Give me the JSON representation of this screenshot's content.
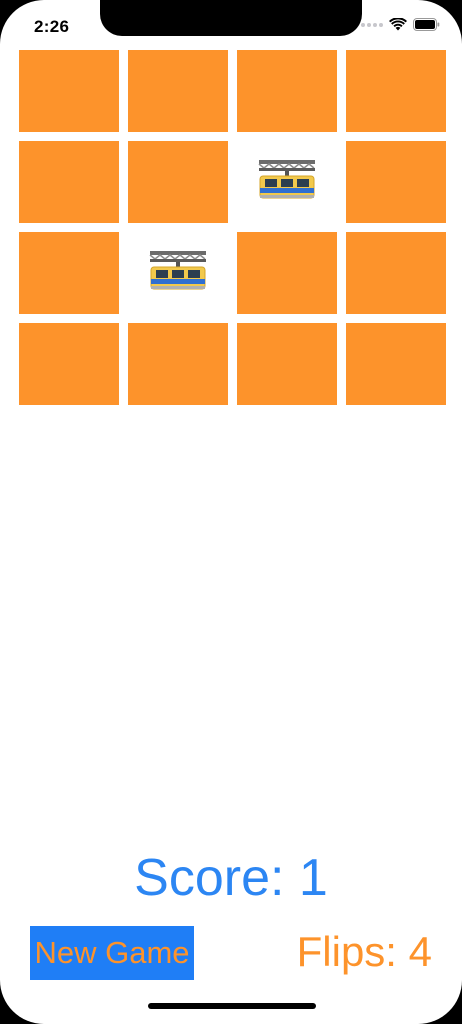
{
  "status_bar": {
    "time": "2:26"
  },
  "game": {
    "cards": [
      {
        "face_up": false,
        "emoji": ""
      },
      {
        "face_up": false,
        "emoji": ""
      },
      {
        "face_up": false,
        "emoji": ""
      },
      {
        "face_up": false,
        "emoji": ""
      },
      {
        "face_up": false,
        "emoji": ""
      },
      {
        "face_up": false,
        "emoji": ""
      },
      {
        "face_up": true,
        "emoji": "suspension-railway-icon"
      },
      {
        "face_up": false,
        "emoji": ""
      },
      {
        "face_up": false,
        "emoji": ""
      },
      {
        "face_up": true,
        "emoji": "suspension-railway-icon"
      },
      {
        "face_up": false,
        "emoji": ""
      },
      {
        "face_up": false,
        "emoji": ""
      },
      {
        "face_up": false,
        "emoji": ""
      },
      {
        "face_up": false,
        "emoji": ""
      },
      {
        "face_up": false,
        "emoji": ""
      },
      {
        "face_up": false,
        "emoji": ""
      }
    ],
    "score_text": "Score: 1",
    "new_game_label": "New Game",
    "flips_text": "Flips: 4"
  },
  "colors": {
    "card_back": "#fd932b",
    "score_text": "#2c86f3",
    "button_bg": "#1f7ef6",
    "accent_orange": "#fd932b"
  }
}
